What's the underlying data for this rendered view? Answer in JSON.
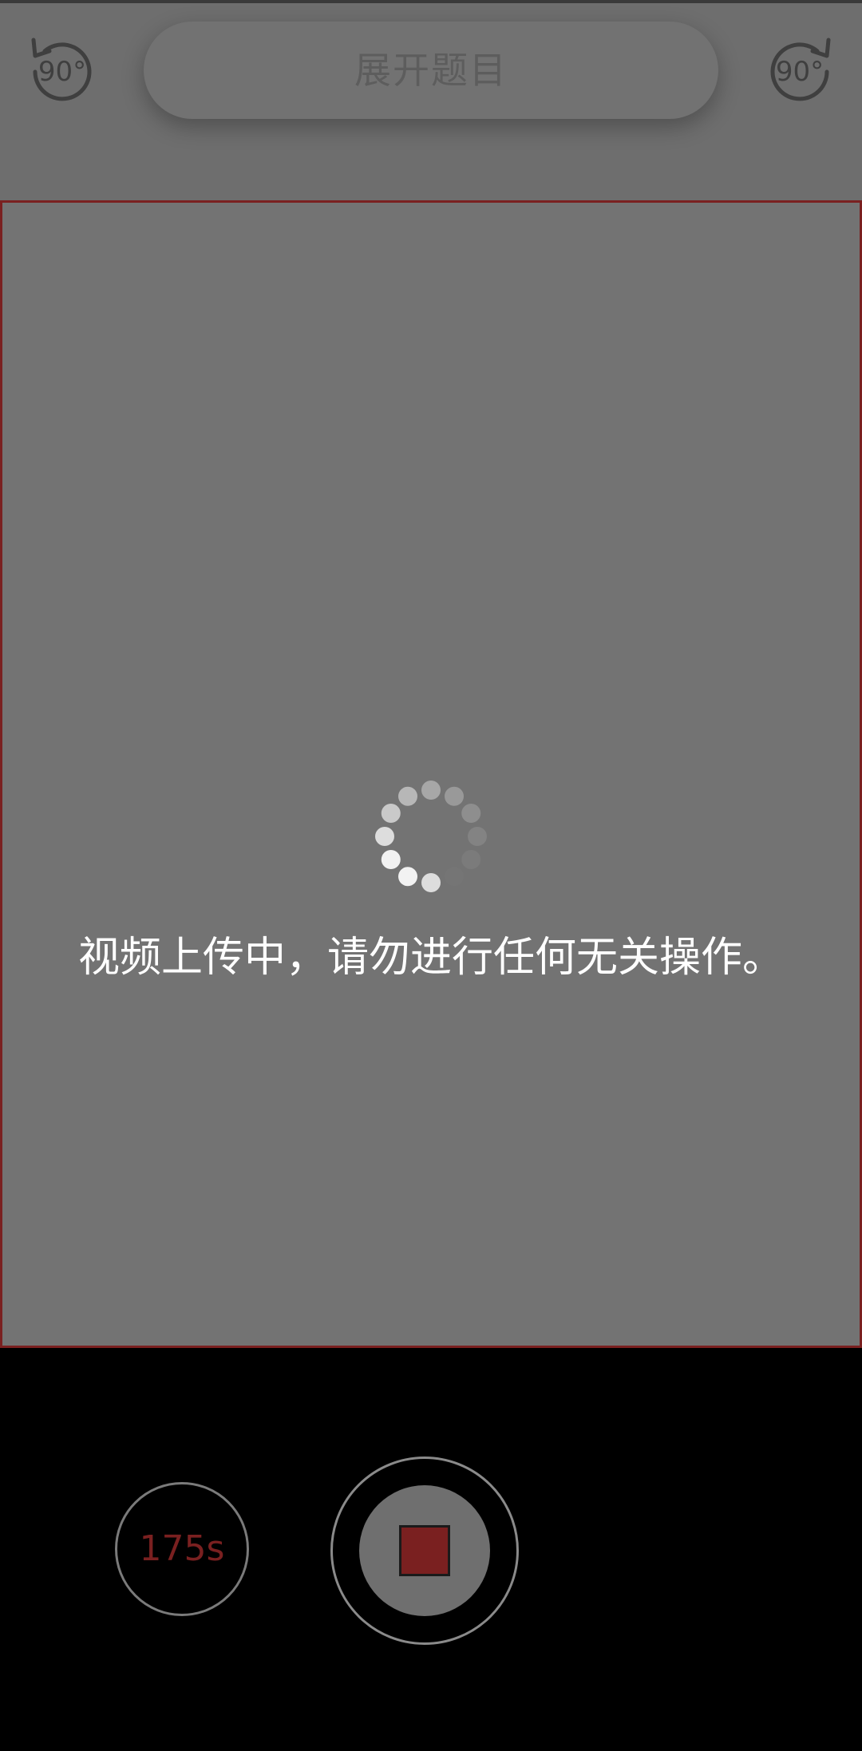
{
  "topbar": {
    "rotate_left_label": "90°",
    "expand_label": "展开题目",
    "rotate_right_label": "90°"
  },
  "preview": {
    "message": "视频上传中，请勿进行任何无关操作。",
    "spinner_icon": "loading-spinner-icon"
  },
  "controls": {
    "timer_label": "175s",
    "record_state": "stop",
    "stop_icon": "stop-square-icon"
  },
  "colors": {
    "accent_red": "#7a2020",
    "preview_bg": "#737373",
    "overlay_bg": "#6e6e6e"
  }
}
